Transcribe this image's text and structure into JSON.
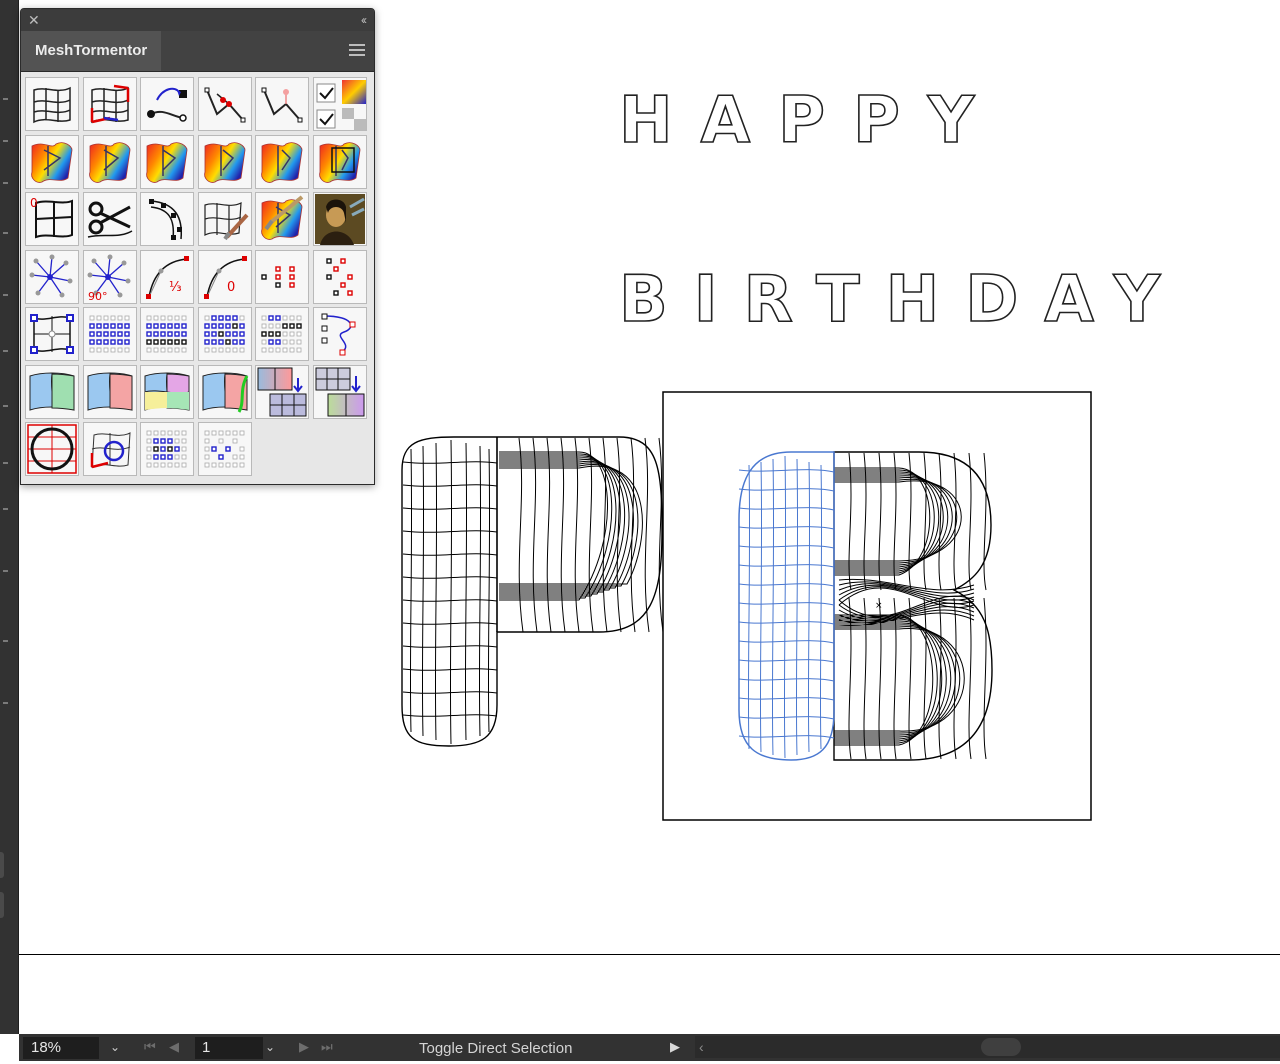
{
  "panel": {
    "title": "MeshTormentor",
    "close_label": "✕",
    "collapse_label": "‹‹",
    "tools": [
      [
        "mesh-distort",
        "mesh-corner-distort",
        "path-rotate-anchor",
        "path-nodes-red",
        "path-nodes-fade",
        "checkbox-pair"
      ],
      [
        "gradient-mesh-1",
        "gradient-mesh-2",
        "gradient-mesh-3",
        "gradient-mesh-4",
        "gradient-mesh-5",
        "gradient-mesh-6"
      ],
      [
        "grid-zero",
        "scissors",
        "arc-nodes",
        "mesh-brush",
        "gradient-brush",
        "mona-lisa-image"
      ],
      [
        "star-handles",
        "star-handles-90",
        "bezier-third",
        "bezier-zero",
        "red-points-grid",
        "red-points-scatter"
      ],
      [
        "envelope-select",
        "blue-dot-grid-1",
        "blue-dot-grid-2",
        "blue-dot-grid-3",
        "blue-dot-grid-4",
        "path-zigzag"
      ],
      [
        "color-patch-warp-1",
        "color-patch-warp-2",
        "color-patch-warp-3",
        "color-patch-warp-4",
        "merge-patches",
        "split-patches"
      ],
      [
        "circle-grid",
        "rotate-mesh",
        "dot-grid-small",
        "dot-grid-sparse"
      ]
    ]
  },
  "canvas": {
    "text_line_1": "HAPPY",
    "text_line_2": "BIRTHDAY"
  },
  "statusbar": {
    "zoom": "18%",
    "page": "1",
    "status_text": "Toggle Direct Selection"
  },
  "colors": {
    "selection_blue": "#4a78d0",
    "ui_dark": "#323232",
    "panel_bg": "#535353"
  }
}
